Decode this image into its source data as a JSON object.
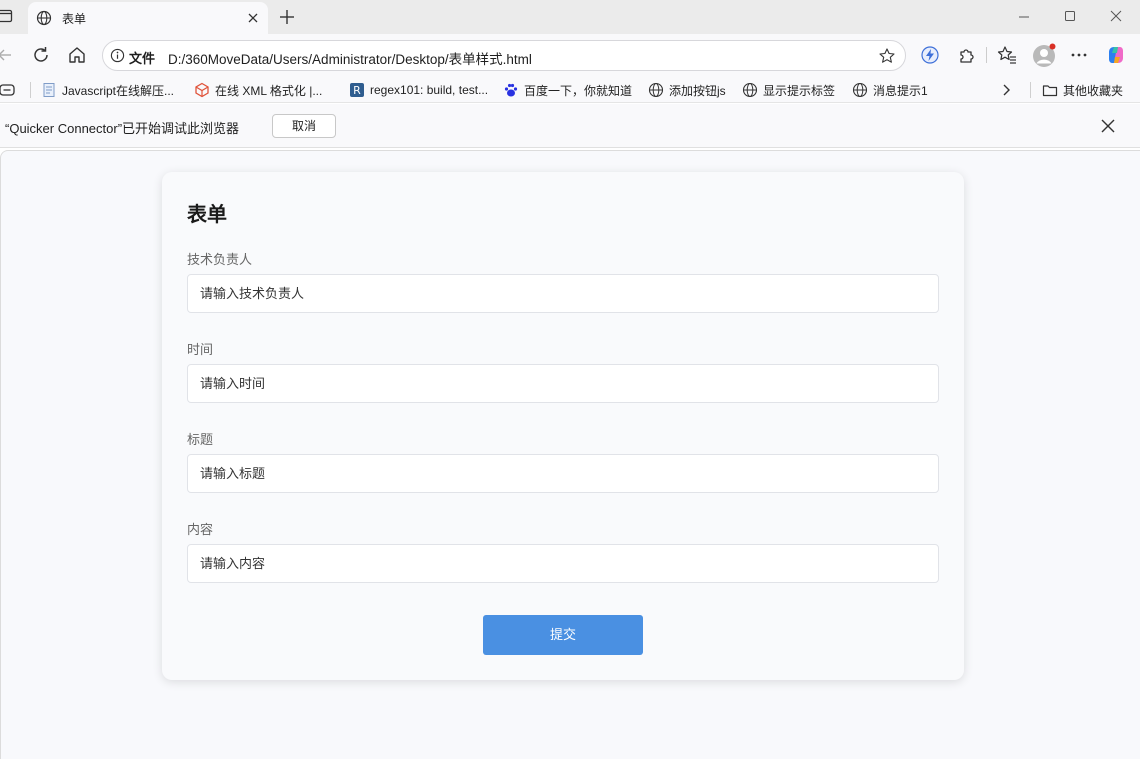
{
  "tab": {
    "title": "表单"
  },
  "address": {
    "scheme": "文件",
    "url": "D:/360MoveData/Users/Administrator/Desktop/表单样式.html"
  },
  "bookmarks": [
    {
      "label": "Javascript在线解压..."
    },
    {
      "label": "在线 XML 格式化 |..."
    },
    {
      "label": "regex101: build, test..."
    },
    {
      "label": "百度一下，你就知道"
    },
    {
      "label": "添加按钮js"
    },
    {
      "label": "显示提示标签"
    },
    {
      "label": "消息提示1"
    }
  ],
  "other_bookmarks": "其他收藏夹",
  "infobar": {
    "message": "“Quicker Connector”已开始调试此浏览器",
    "cancel_label": "取消"
  },
  "form": {
    "title": "表单",
    "fields": [
      {
        "label": "技术负责人",
        "placeholder": "请输入技术负责人"
      },
      {
        "label": "时间",
        "placeholder": "请输入时间"
      },
      {
        "label": "标题",
        "placeholder": "请输入标题"
      },
      {
        "label": "内容",
        "placeholder": "请输入内容"
      }
    ],
    "submit_label": "提交"
  },
  "colors": {
    "submit": "#4a90e2",
    "page_bg": "#f8f9fc",
    "tab_bar": "#ebebeb"
  },
  "icons": [
    "sidebar-icon",
    "globe-icon",
    "close-icon",
    "plus-icon",
    "minimize-icon",
    "maximize-icon",
    "back-icon",
    "refresh-icon",
    "home-icon",
    "info-icon",
    "star-icon",
    "extension-icon",
    "favorites-icon",
    "profile-icon",
    "more-icon",
    "copilot-icon",
    "folder-icon",
    "chevron-right-icon"
  ]
}
